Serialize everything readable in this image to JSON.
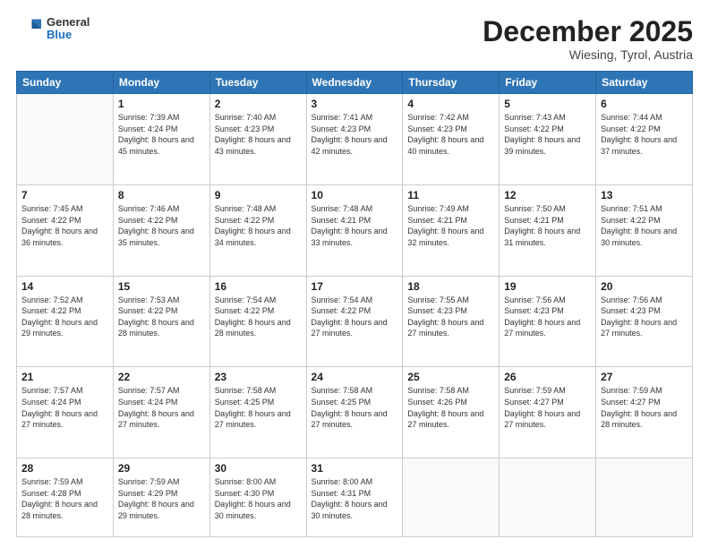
{
  "header": {
    "logo": {
      "general": "General",
      "blue": "Blue"
    },
    "title": "December 2025",
    "location": "Wiesing, Tyrol, Austria"
  },
  "days_of_week": [
    "Sunday",
    "Monday",
    "Tuesday",
    "Wednesday",
    "Thursday",
    "Friday",
    "Saturday"
  ],
  "weeks": [
    [
      {
        "day": "",
        "sunrise": "",
        "sunset": "",
        "daylight": ""
      },
      {
        "day": "1",
        "sunrise": "7:39 AM",
        "sunset": "4:24 PM",
        "daylight": "8 hours and 45 minutes."
      },
      {
        "day": "2",
        "sunrise": "7:40 AM",
        "sunset": "4:23 PM",
        "daylight": "8 hours and 43 minutes."
      },
      {
        "day": "3",
        "sunrise": "7:41 AM",
        "sunset": "4:23 PM",
        "daylight": "8 hours and 42 minutes."
      },
      {
        "day": "4",
        "sunrise": "7:42 AM",
        "sunset": "4:23 PM",
        "daylight": "8 hours and 40 minutes."
      },
      {
        "day": "5",
        "sunrise": "7:43 AM",
        "sunset": "4:22 PM",
        "daylight": "8 hours and 39 minutes."
      },
      {
        "day": "6",
        "sunrise": "7:44 AM",
        "sunset": "4:22 PM",
        "daylight": "8 hours and 37 minutes."
      }
    ],
    [
      {
        "day": "7",
        "sunrise": "7:45 AM",
        "sunset": "4:22 PM",
        "daylight": "8 hours and 36 minutes."
      },
      {
        "day": "8",
        "sunrise": "7:46 AM",
        "sunset": "4:22 PM",
        "daylight": "8 hours and 35 minutes."
      },
      {
        "day": "9",
        "sunrise": "7:48 AM",
        "sunset": "4:22 PM",
        "daylight": "8 hours and 34 minutes."
      },
      {
        "day": "10",
        "sunrise": "7:48 AM",
        "sunset": "4:21 PM",
        "daylight": "8 hours and 33 minutes."
      },
      {
        "day": "11",
        "sunrise": "7:49 AM",
        "sunset": "4:21 PM",
        "daylight": "8 hours and 32 minutes."
      },
      {
        "day": "12",
        "sunrise": "7:50 AM",
        "sunset": "4:21 PM",
        "daylight": "8 hours and 31 minutes."
      },
      {
        "day": "13",
        "sunrise": "7:51 AM",
        "sunset": "4:22 PM",
        "daylight": "8 hours and 30 minutes."
      }
    ],
    [
      {
        "day": "14",
        "sunrise": "7:52 AM",
        "sunset": "4:22 PM",
        "daylight": "8 hours and 29 minutes."
      },
      {
        "day": "15",
        "sunrise": "7:53 AM",
        "sunset": "4:22 PM",
        "daylight": "8 hours and 28 minutes."
      },
      {
        "day": "16",
        "sunrise": "7:54 AM",
        "sunset": "4:22 PM",
        "daylight": "8 hours and 28 minutes."
      },
      {
        "day": "17",
        "sunrise": "7:54 AM",
        "sunset": "4:22 PM",
        "daylight": "8 hours and 27 minutes."
      },
      {
        "day": "18",
        "sunrise": "7:55 AM",
        "sunset": "4:23 PM",
        "daylight": "8 hours and 27 minutes."
      },
      {
        "day": "19",
        "sunrise": "7:56 AM",
        "sunset": "4:23 PM",
        "daylight": "8 hours and 27 minutes."
      },
      {
        "day": "20",
        "sunrise": "7:56 AM",
        "sunset": "4:23 PM",
        "daylight": "8 hours and 27 minutes."
      }
    ],
    [
      {
        "day": "21",
        "sunrise": "7:57 AM",
        "sunset": "4:24 PM",
        "daylight": "8 hours and 27 minutes."
      },
      {
        "day": "22",
        "sunrise": "7:57 AM",
        "sunset": "4:24 PM",
        "daylight": "8 hours and 27 minutes."
      },
      {
        "day": "23",
        "sunrise": "7:58 AM",
        "sunset": "4:25 PM",
        "daylight": "8 hours and 27 minutes."
      },
      {
        "day": "24",
        "sunrise": "7:58 AM",
        "sunset": "4:25 PM",
        "daylight": "8 hours and 27 minutes."
      },
      {
        "day": "25",
        "sunrise": "7:58 AM",
        "sunset": "4:26 PM",
        "daylight": "8 hours and 27 minutes."
      },
      {
        "day": "26",
        "sunrise": "7:59 AM",
        "sunset": "4:27 PM",
        "daylight": "8 hours and 27 minutes."
      },
      {
        "day": "27",
        "sunrise": "7:59 AM",
        "sunset": "4:27 PM",
        "daylight": "8 hours and 28 minutes."
      }
    ],
    [
      {
        "day": "28",
        "sunrise": "7:59 AM",
        "sunset": "4:28 PM",
        "daylight": "8 hours and 28 minutes."
      },
      {
        "day": "29",
        "sunrise": "7:59 AM",
        "sunset": "4:29 PM",
        "daylight": "8 hours and 29 minutes."
      },
      {
        "day": "30",
        "sunrise": "8:00 AM",
        "sunset": "4:30 PM",
        "daylight": "8 hours and 30 minutes."
      },
      {
        "day": "31",
        "sunrise": "8:00 AM",
        "sunset": "4:31 PM",
        "daylight": "8 hours and 30 minutes."
      },
      {
        "day": "",
        "sunrise": "",
        "sunset": "",
        "daylight": ""
      },
      {
        "day": "",
        "sunrise": "",
        "sunset": "",
        "daylight": ""
      },
      {
        "day": "",
        "sunrise": "",
        "sunset": "",
        "daylight": ""
      }
    ]
  ]
}
